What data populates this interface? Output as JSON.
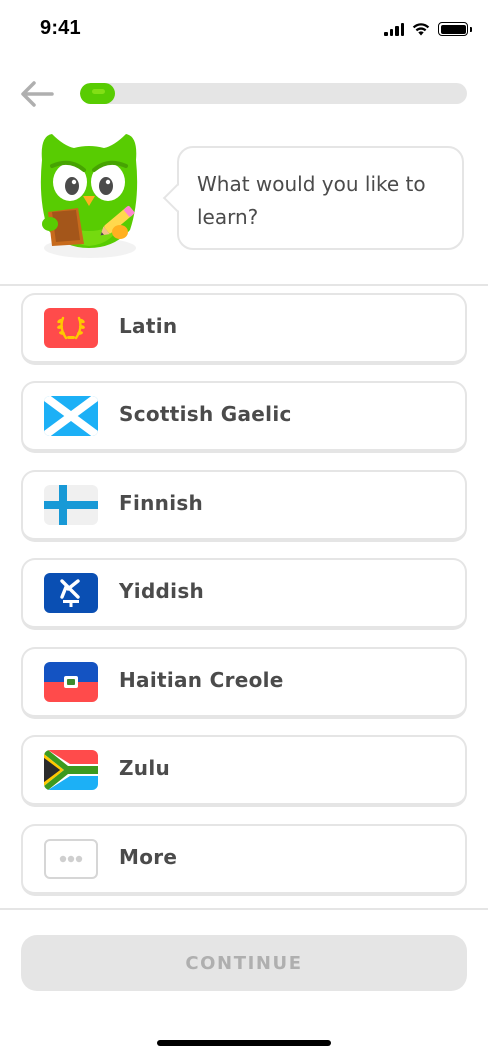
{
  "status_bar": {
    "time": "9:41",
    "icons": [
      "signal-icon",
      "wifi-icon",
      "battery-icon"
    ]
  },
  "header": {
    "back_icon": "arrow-left-icon",
    "progress_fraction": 0.09
  },
  "prompt": {
    "mascot": "duo-owl-mascot",
    "text": "What would you like to learn?"
  },
  "courses": [
    {
      "label": "Latin",
      "flag": "latin-flag-icon"
    },
    {
      "label": "Scottish Gaelic",
      "flag": "scotland-flag-icon"
    },
    {
      "label": "Finnish",
      "flag": "finland-flag-icon"
    },
    {
      "label": "Yiddish",
      "flag": "yiddish-flag-icon"
    },
    {
      "label": "Haitian Creole",
      "flag": "haiti-flag-icon"
    },
    {
      "label": "Zulu",
      "flag": "south-africa-flag-icon"
    },
    {
      "label": "More",
      "flag": "more-dots-icon"
    }
  ],
  "footer": {
    "continue_label": "CONTINUE",
    "continue_enabled": false
  },
  "colors": {
    "brand_green": "#58cc02",
    "border_gray": "#e5e5e5",
    "text_gray": "#4b4b4b",
    "disabled_text": "#afafaf"
  }
}
